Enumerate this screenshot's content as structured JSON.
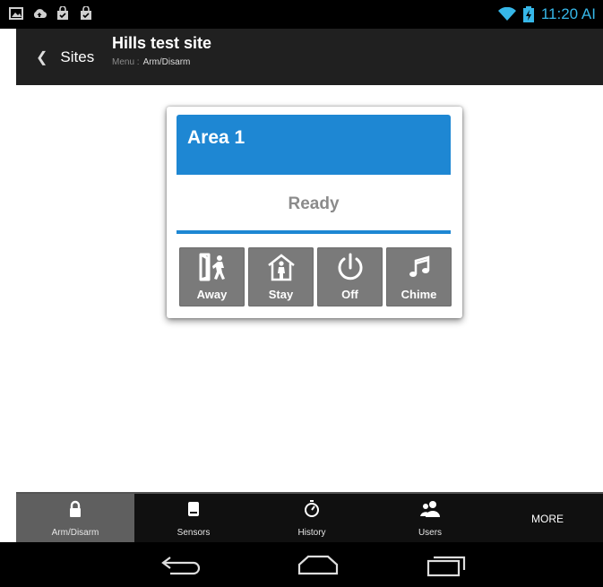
{
  "status": {
    "icons": [
      "image-icon",
      "cloud-upload-icon",
      "shopping-bag-icon",
      "shopping-bag-icon"
    ],
    "time": "11:20 AI"
  },
  "header": {
    "back_label": "Sites",
    "title": "Hills test site",
    "menu_prefix": "Menu :",
    "menu_value": "Arm/Disarm"
  },
  "area": {
    "name": "Area 1",
    "state": "Ready",
    "accent_color": "#1e87d3",
    "buttons": [
      {
        "label": "Away",
        "icon": "door-person-icon"
      },
      {
        "label": "Stay",
        "icon": "house-person-icon"
      },
      {
        "label": "Off",
        "icon": "power-icon"
      },
      {
        "label": "Chime",
        "icon": "music-notes-icon"
      }
    ]
  },
  "bottom_nav": {
    "tabs": [
      {
        "label": "Arm/Disarm",
        "icon": "lock-icon",
        "active": true
      },
      {
        "label": "Sensors",
        "icon": "sensor-icon",
        "active": false
      },
      {
        "label": "History",
        "icon": "stopwatch-icon",
        "active": false
      },
      {
        "label": "Users",
        "icon": "users-icon",
        "active": false
      }
    ],
    "more_label": "MORE"
  },
  "system_nav": [
    "back-icon",
    "home-icon",
    "recent-apps-icon"
  ]
}
